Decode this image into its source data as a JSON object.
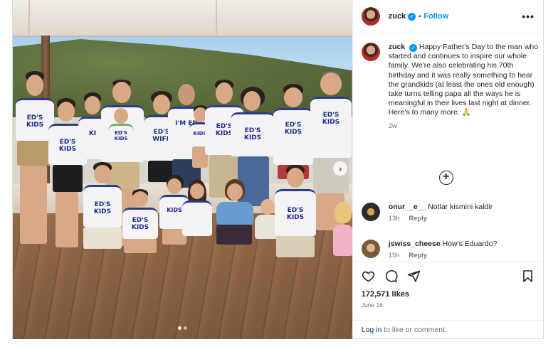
{
  "post": {
    "author": "zuck",
    "follow_label": "Follow",
    "separator": "•",
    "more_label": "•••",
    "verified_glyph": "✓"
  },
  "photo": {
    "shirt_texts": {
      "eds_kids": [
        "ED'S",
        "KIDS"
      ],
      "eds_wife": [
        "ED'S",
        "WIFE"
      ],
      "im_ed": [
        "I'M ED"
      ]
    },
    "next_icon": "chevron-right-icon",
    "slide_index": 1,
    "slide_count": 2
  },
  "caption": {
    "username": "zuck",
    "text": "Happy Father's Day to the man who started and continues to inspire our whole family. We're also celebrating his 70th birthday and it was really something to hear the grandkids (at least the ones old enough) take turns telling papa all the ways he is meaningful in their lives last night at dinner. Here's to many more. 🙏",
    "time": "2w"
  },
  "comments": [
    {
      "username": "onur__e__",
      "text": "Notlar kismini kaldir",
      "time": "13h",
      "reply_label": "Reply",
      "avatar_color": "#2b2b2b"
    },
    {
      "username": "jswiss_cheese",
      "text": "How's Eduardo?",
      "time": "15h",
      "reply_label": "Reply",
      "avatar_color": "#7a5a3a"
    }
  ],
  "actions": {
    "likes": "172,571 likes",
    "date": "June 16",
    "icons": [
      "heart-icon",
      "comment-icon",
      "share-icon",
      "bookmark-icon"
    ]
  },
  "login": {
    "link_text": "Log in",
    "rest_text": " to like or comment."
  },
  "colors": {
    "accent": "#0095f6",
    "link": "#00376b",
    "muted": "#737373",
    "text": "#262626"
  }
}
